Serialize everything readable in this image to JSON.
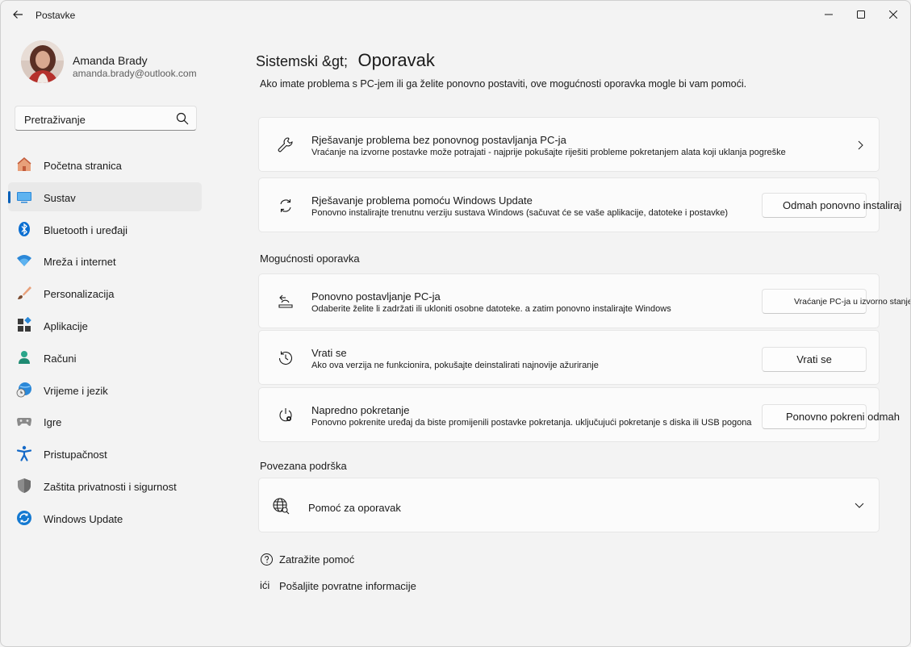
{
  "window": {
    "title": "Postavke"
  },
  "profile": {
    "name": "Amanda Brady",
    "email": "amanda.brady@outlook.com"
  },
  "search": {
    "placeholder": "Pretraživanje"
  },
  "sidebar": {
    "items": [
      {
        "label": "Početna stranica",
        "icon": "home-icon",
        "active": false
      },
      {
        "label": "Sustav",
        "icon": "system-icon",
        "active": true
      },
      {
        "label": "Bluetooth i uređaji",
        "icon": "bluetooth-icon",
        "active": false
      },
      {
        "label": "Mreža i internet",
        "icon": "wifi-icon",
        "active": false
      },
      {
        "label": "Personalizacija",
        "icon": "brush-icon",
        "active": false
      },
      {
        "label": "Aplikacije",
        "icon": "apps-icon",
        "active": false
      },
      {
        "label": "Računi",
        "icon": "accounts-icon",
        "active": false
      },
      {
        "label": "Vrijeme i jezik",
        "icon": "time-language-icon",
        "active": false
      },
      {
        "label": "Igre",
        "icon": "gaming-icon",
        "active": false
      },
      {
        "label": "Pristupačnost",
        "icon": "accessibility-icon",
        "active": false
      },
      {
        "label": "Zaštita privatnosti i sigurnost",
        "icon": "shield-icon",
        "active": false
      },
      {
        "label": "Windows Update",
        "icon": "windows-update-icon",
        "active": false
      }
    ]
  },
  "breadcrumb": {
    "parent": "Sistemski &gt;",
    "current": "Oporavak"
  },
  "page": {
    "description": "Ako imate problema s PC-jem ili ga želite ponovno postaviti, ove mogućnosti oporavka mogle bi vam pomoći."
  },
  "cards": {
    "fix_without_reset": {
      "title": "Rješavanje problema bez ponovnog postavljanja PC-ja",
      "subtitle": "Vraćanje na izvorne postavke može potrajati - najprije pokušajte riješiti probleme pokretanjem alata koji uklanja pogreške"
    },
    "windows_update_fix": {
      "title": "Rješavanje problema pomoću Windows Update",
      "subtitle": "Ponovno instalirajte trenutnu verziju sustava Windows (sačuvat će se vaše aplikacije, datoteke i postavke)",
      "button": "Odmah ponovno instaliraj"
    }
  },
  "recovery_options": {
    "heading": "Mogućnosti oporavka",
    "reset_pc": {
      "title": "Ponovno postavljanje PC-ja",
      "subtitle": "Odaberite želite li zadržati ili ukloniti osobne datoteke. a zatim ponovno instalirajte Windows",
      "button": "Vraćanje PC-ja u izvorno stanje"
    },
    "go_back": {
      "title": "Vrati se",
      "subtitle": "Ako ova verzija ne funkcionira, pokušajte deinstalirati najnovije ažuriranje",
      "button": "Vrati se"
    },
    "advanced_startup": {
      "title": "Napredno pokretanje",
      "subtitle": "Ponovno pokrenite uređaj da biste promijenili postavke pokretanja. uključujući pokretanje s diska ili USB pogona",
      "button": "Ponovno pokreni odmah"
    }
  },
  "related": {
    "heading": "Povezana podrška",
    "help_item": "Pomoć za oporavak"
  },
  "footer_links": {
    "get_help": "Zatražite pomoć",
    "feedback_icon_text": "ići",
    "feedback": "Pošaljite povratne informacije"
  },
  "colors": {
    "accent": "#005fb8",
    "background": "#f3f3f3",
    "card": "#fbfbfb"
  }
}
